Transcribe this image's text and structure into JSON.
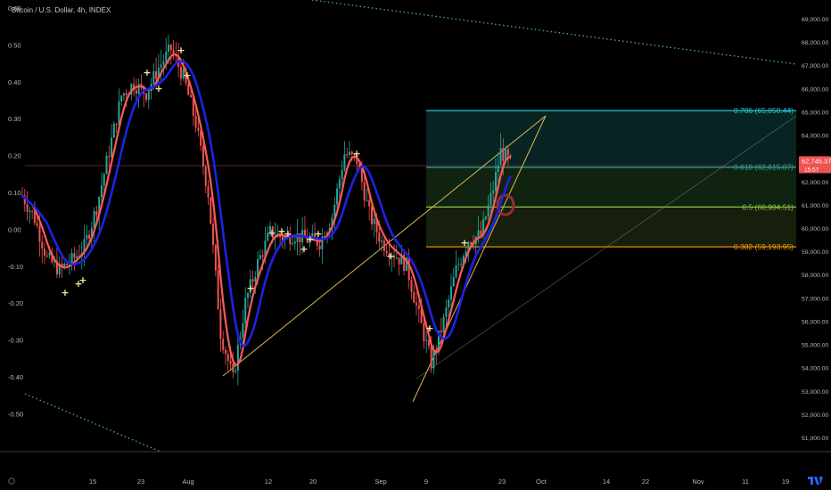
{
  "header": {
    "title": "Bitcoin / U.S. Dollar, 4h, INDEX"
  },
  "colors": {
    "background": "#000000",
    "up_candle": "#26a69a",
    "down_candle": "#ef5350",
    "sma_blue": "#1e22e6",
    "ema_red": "#ff5a5a",
    "fib_0786": "#26c6da",
    "fib_0618": "#26a69a",
    "fib_05": "#8bc34a",
    "fib_0382": "#ff9800",
    "wedge_line": "#e0b455",
    "dotted_green": "#4caf50",
    "price_badge": "#ef5350"
  },
  "chart_data": {
    "type": "candlestick",
    "symbol": "Bitcoin / U.S. Dollar",
    "timeframe": "4h",
    "x_ticks": [
      "15",
      "23",
      "Aug",
      "12",
      "20",
      "Sep",
      "9",
      "23",
      "Oct",
      "14",
      "22",
      "Nov",
      "11",
      "19"
    ],
    "left_axis_ticks": [
      "0.60",
      "0.50",
      "0.40",
      "0.30",
      "0.20",
      "0.10",
      "0.00",
      "-0.10",
      "-0.20",
      "-0.30",
      "-0.40",
      "-0.50"
    ],
    "right_axis_ticks": [
      "69,000.00",
      "68,000.00",
      "67,000.00",
      "66,000.00",
      "65,000.00",
      "64,000.00",
      "63,000.00",
      "62,000.00",
      "61,000.00",
      "60,000.00",
      "59,000.00",
      "58,000.00",
      "57,000.00",
      "56,000.00",
      "55,000.00",
      "54,000.00",
      "53,000.00",
      "52,000.00",
      "51,000.00"
    ],
    "y_range": [
      50600,
      69400
    ],
    "fib_levels": [
      {
        "label": "0.786 (65,050.44)",
        "price": 65050.44
      },
      {
        "label": "0.618 (62,615.07)",
        "price": 62615.07
      },
      {
        "label": "0.5 (60,904.51)",
        "price": 60904.51
      },
      {
        "label": "0.382 (59,193.95)",
        "price": 59193.95
      }
    ],
    "current_price": "62,745.37",
    "countdown": "15:57",
    "price_path": [
      [
        0,
        61400
      ],
      [
        5,
        60400
      ],
      [
        10,
        58700
      ],
      [
        15,
        58200
      ],
      [
        20,
        58600
      ],
      [
        25,
        59200
      ],
      [
        30,
        60900
      ],
      [
        35,
        63300
      ],
      [
        40,
        65700
      ],
      [
        45,
        66200
      ],
      [
        50,
        65800
      ],
      [
        55,
        66900
      ],
      [
        60,
        67700
      ],
      [
        65,
        66500
      ],
      [
        70,
        64500
      ],
      [
        75,
        61500
      ],
      [
        80,
        55500
      ],
      [
        85,
        53500
      ],
      [
        90,
        56800
      ],
      [
        95,
        58500
      ],
      [
        100,
        59800
      ],
      [
        105,
        59600
      ],
      [
        110,
        59700
      ],
      [
        115,
        59500
      ],
      [
        120,
        59400
      ],
      [
        125,
        60500
      ],
      [
        130,
        63200
      ],
      [
        135,
        62900
      ],
      [
        140,
        60600
      ],
      [
        145,
        59400
      ],
      [
        150,
        58900
      ],
      [
        155,
        58400
      ],
      [
        160,
        56200
      ],
      [
        165,
        54200
      ],
      [
        170,
        56000
      ],
      [
        175,
        58200
      ],
      [
        180,
        59500
      ],
      [
        185,
        59700
      ],
      [
        190,
        61700
      ],
      [
        193,
        63300
      ],
      [
        197,
        62800
      ]
    ]
  }
}
